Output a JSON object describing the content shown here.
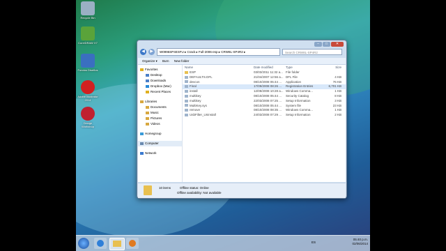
{
  "desktop_icons": [
    {
      "label": "Recycle Bin",
      "color": "#9ab0c4"
    },
    {
      "label": "CorelDRAW X7",
      "color": "#5aa33a"
    },
    {
      "label": "Fondos Diseños",
      "color": "#3a6fc0"
    },
    {
      "label": "Adobe Illustrator 2014",
      "color": "#d12020"
    },
    {
      "label": "Design Workshop",
      "color": "#c02030"
    }
  ],
  "window": {
    "address": "W0996SP4ESFU ▸ Crack ▸ Full-2006-esp ▸ CRW8L-SP4R2 ▸",
    "search_placeholder": "Search CRW8L-SP4R2",
    "toolbar": {
      "organize": "Organize ▾",
      "burn": "Burn",
      "new_folder": "New folder"
    },
    "nav": {
      "favorites": "Favorites",
      "desktop": "Desktop",
      "downloads": "Downloads",
      "dropbox": "Dropbox (Mac)",
      "recent": "Recent Places",
      "libraries": "Libraries",
      "documents": "Documents",
      "music": "Music",
      "pictures": "Pictures",
      "videos": "Videos",
      "homegroup": "Homegroup",
      "computer": "Computer",
      "network": "Network"
    },
    "columns": {
      "name": "Name",
      "date": "Date modified",
      "type": "Type",
      "size": "Size"
    },
    "files": [
      {
        "name": "ESP",
        "date": "03/03/2011 11:32 a...",
        "type": "File folder",
        "size": ""
      },
      {
        "name": "DEFAULTS.DFL",
        "date": "21/04/2007 12:56 a...",
        "type": "DFL File",
        "size": "4 KB"
      },
      {
        "name": "devcon",
        "date": "08/10/2008 05:44 ...",
        "type": "Application",
        "size": "76 KB"
      },
      {
        "name": "Final",
        "date": "17/09/2008 08:26 ...",
        "type": "Registration Entries",
        "size": "6,701 KB"
      },
      {
        "name": "install",
        "date": "12/08/2008 10:28 a...",
        "type": "Windows Comma...",
        "size": "1 KB"
      },
      {
        "name": "multikey",
        "date": "08/10/2008 05:44 ...",
        "type": "Security Catalog",
        "size": "8 KB"
      },
      {
        "name": "multikey",
        "date": "22/03/2008 07:25 ...",
        "type": "Setup Information",
        "size": "3 KB"
      },
      {
        "name": "MultiKey.sys",
        "date": "08/10/2008 05:44 ...",
        "type": "System file",
        "size": "23 KB"
      },
      {
        "name": "remove",
        "date": "08/10/2008 08:35 ...",
        "type": "Windows Comma...",
        "size": "1 KB"
      },
      {
        "name": "UsbFilter_Uninstall",
        "date": "24/03/2008 07:29 ...",
        "type": "Setup Information",
        "size": "2 KB"
      }
    ],
    "details": {
      "count": "10 items",
      "offline_status": "Offline status: Online",
      "availability": "Offline availability: Not available"
    }
  },
  "taskbar": {
    "lang": "ES",
    "time": "05:40 p.m.",
    "date": "02/06/2014"
  }
}
